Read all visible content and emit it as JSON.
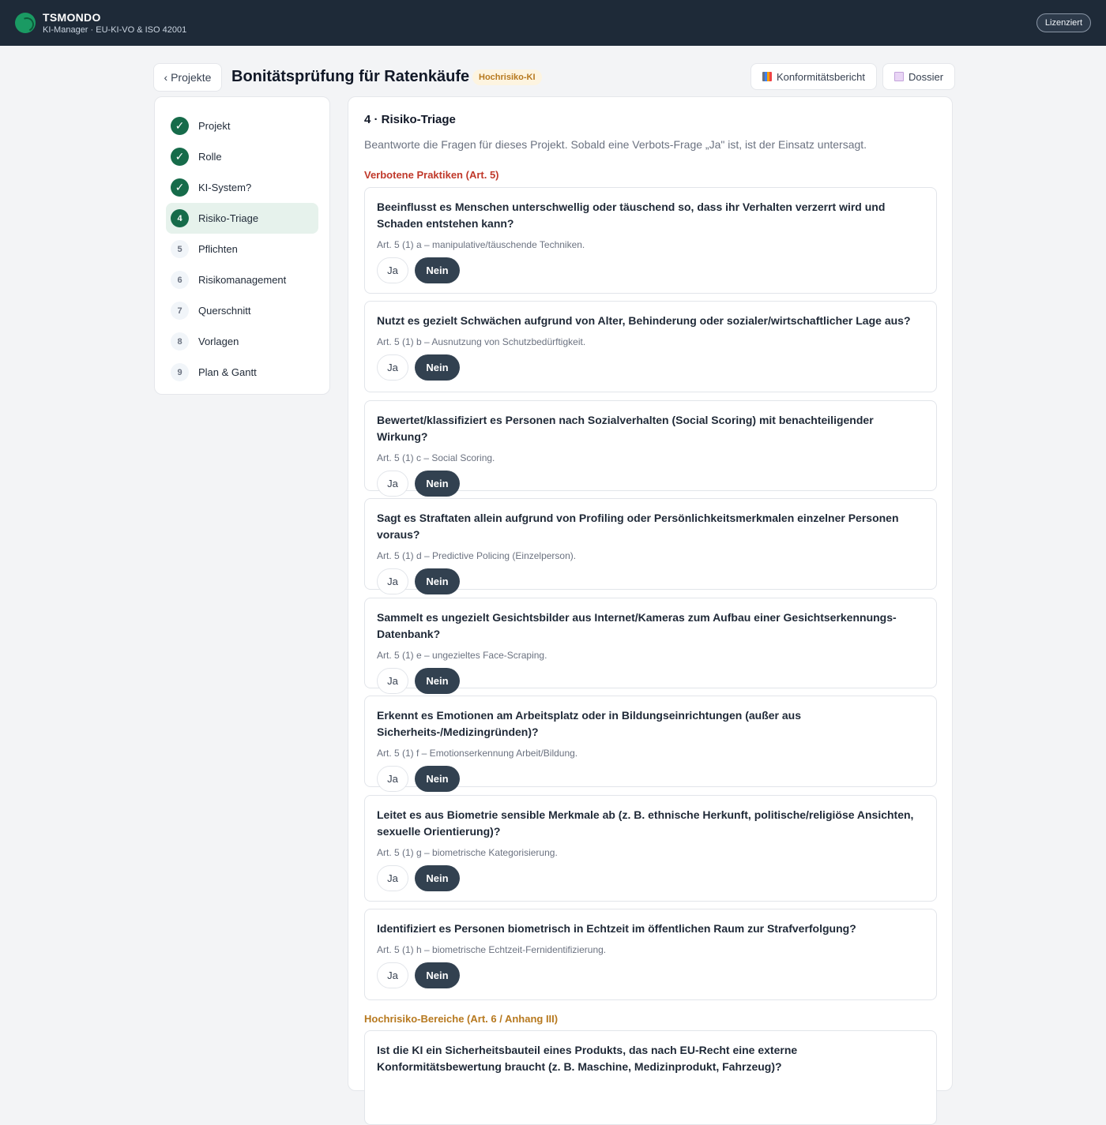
{
  "app": {
    "brand": "TSMONDO",
    "subtitle": "KI-Manager · EU-KI-VO & ISO 42001",
    "license": "Lizenziert"
  },
  "header": {
    "back_label": "‹ Projekte",
    "title": "Bonitätsprüfung für Ratenkäufe",
    "badge": "Hochrisiko-KI",
    "report_label": "Konformitätsbericht",
    "dossier_label": "Dossier"
  },
  "steps": [
    {
      "num": "✓",
      "label": "Projekt",
      "state": "done"
    },
    {
      "num": "✓",
      "label": "Rolle",
      "state": "done"
    },
    {
      "num": "✓",
      "label": "KI-System?",
      "state": "done"
    },
    {
      "num": "4",
      "label": "Risiko-Triage",
      "state": "current"
    },
    {
      "num": "5",
      "label": "Pflichten",
      "state": "todo"
    },
    {
      "num": "6",
      "label": "Risikomanagement",
      "state": "todo"
    },
    {
      "num": "7",
      "label": "Querschnitt",
      "state": "todo"
    },
    {
      "num": "8",
      "label": "Vorlagen",
      "state": "todo"
    },
    {
      "num": "9",
      "label": "Plan & Gantt",
      "state": "todo"
    }
  ],
  "section": {
    "title": "4 · Risiko-Triage",
    "description": "Beantworte die Fragen für dieses Projekt. Sobald eine Verbots-Frage „Ja\" ist, ist der Einsatz untersagt.",
    "category_prohibited": "Verbotene Praktiken (Art. 5)",
    "category_highrisk": "Hochrisiko-Bereiche (Art. 6 / Anhang III)",
    "yes_label": "Ja",
    "no_label": "Nein"
  },
  "questions": [
    {
      "text": "Beeinflusst es Menschen unterschwellig oder täuschend so, dass ihr Verhalten verzerrt wird und Schaden entstehen kann?",
      "ref": "Art. 5 (1) a – manipulative/täuschende Techniken.",
      "answer": "Nein"
    },
    {
      "text": "Nutzt es gezielt Schwächen aufgrund von Alter, Behinderung oder sozialer/wirtschaftlicher Lage aus?",
      "ref": "Art. 5 (1) b – Ausnutzung von Schutzbedürftigkeit.",
      "answer": "Nein"
    },
    {
      "text": "Bewertet/klassifiziert es Personen nach Sozialverhalten (Social Scoring) mit benachteiligender Wirkung?",
      "ref": "Art. 5 (1) c – Social Scoring.",
      "answer": "Nein"
    },
    {
      "text": "Sagt es Straftaten allein aufgrund von Profiling oder Persönlichkeitsmerkmalen einzelner Personen voraus?",
      "ref": "Art. 5 (1) d – Predictive Policing (Einzelperson).",
      "answer": "Nein"
    },
    {
      "text": "Sammelt es ungezielt Gesichtsbilder aus Internet/Kameras zum Aufbau einer Gesichtserkennungs-Datenbank?",
      "ref": "Art. 5 (1) e – ungezieltes Face-Scraping.",
      "answer": "Nein"
    },
    {
      "text": "Erkennt es Emotionen am Arbeitsplatz oder in Bildungseinrichtungen (außer aus Sicherheits-/Medizingründen)?",
      "ref": "Art. 5 (1) f – Emotionserkennung Arbeit/Bildung.",
      "answer": "Nein"
    },
    {
      "text": "Leitet es aus Biometrie sensible Merkmale ab (z. B. ethnische Herkunft, politische/religiöse Ansichten, sexuelle Orientierung)?",
      "ref": "Art. 5 (1) g – biometrische Kategorisierung.",
      "answer": "Nein"
    },
    {
      "text": "Identifiziert es Personen biometrisch in Echtzeit im öffentlichen Raum zur Strafverfolgung?",
      "ref": "Art. 5 (1) h – biometrische Echtzeit-Fernidentifizierung.",
      "answer": "Nein"
    },
    {
      "text": "Ist die KI ein Sicherheitsbauteil eines Produkts, das nach EU-Recht eine externe Konformitätsbewertung braucht (z. B. Maschine, Medizinprodukt, Fahrzeug)?",
      "ref": "",
      "answer": ""
    }
  ]
}
